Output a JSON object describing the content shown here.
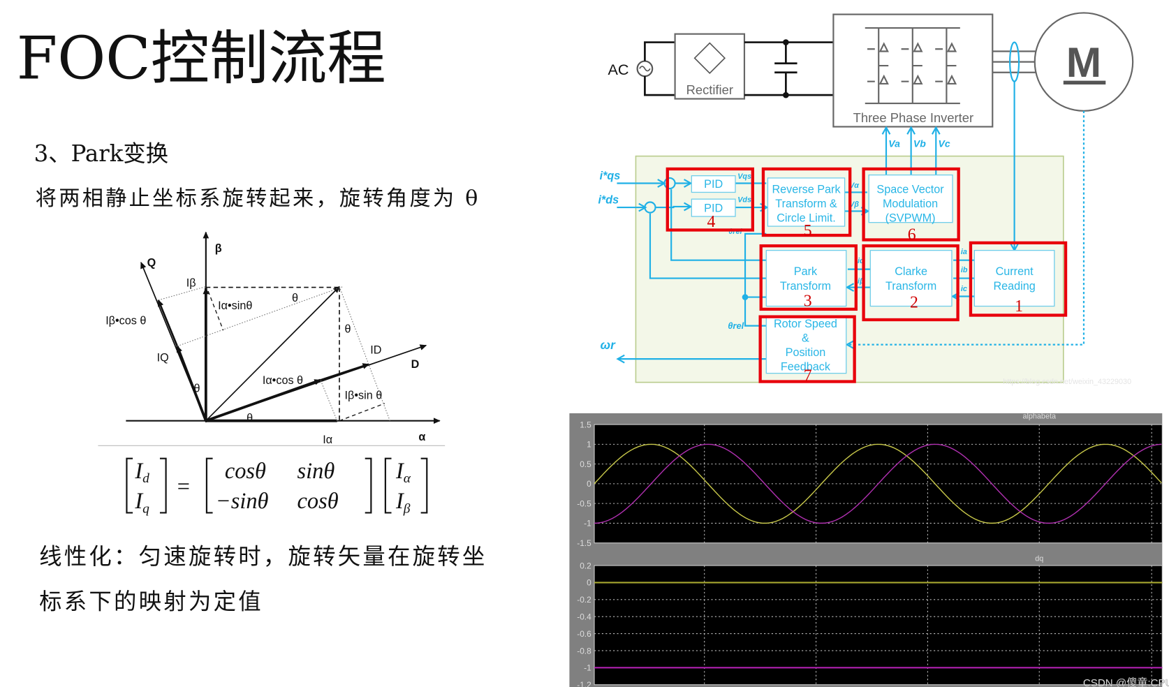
{
  "slide": {
    "title": "FOC控制流程",
    "subtitle": "3、Park变换",
    "description": "将两相静止坐标系旋转起来，旋转角度为 θ",
    "conclusion_line1": "线性化：匀速旋转时，旋转矢量在旋转坐",
    "conclusion_line2": "标系下的映射为定值",
    "watermark": "CSDN @傻童:CPU",
    "faint_url": "https://blog.csdn.net/weixin_43229030"
  },
  "phasor": {
    "alpha_axis": "α",
    "beta_axis": "β",
    "q_axis": "Q",
    "d_axis": "D",
    "i_beta": "Iβ",
    "i_alpha": "Iα",
    "i_alpha_sin": "Iα•sinθ",
    "i_beta_cos": "Iβ•cos θ",
    "iq": "IQ",
    "id": "ID",
    "i_alpha_cos": "Iα•cos θ",
    "i_beta_sin": "Iβ•sin θ",
    "theta": "θ"
  },
  "equation": {
    "lhs": [
      "I_d",
      "I_q"
    ],
    "matrix": [
      [
        "cosθ",
        "sinθ"
      ],
      [
        "−sinθ",
        "cosθ"
      ]
    ],
    "rhs": [
      "I_α",
      "I_β"
    ],
    "equals": "="
  },
  "power_stage": {
    "ac": "AC",
    "rectifier": "Rectifier",
    "inverter": "Three Phase Inverter",
    "motor": "M"
  },
  "control": {
    "inputs": [
      "i*qs",
      "i*ds"
    ],
    "output": "ωr",
    "voltages": [
      "Va",
      "Vb",
      "Vc"
    ],
    "signals": {
      "vqs": "Vqs",
      "vds": "Vds",
      "valpha": "Vα",
      "vbeta": "Vβ",
      "theta_rel": "θrel",
      "ia": "ia",
      "ib": "ib",
      "ic": "ic",
      "ialpha": "iα",
      "ibeta": "iβ"
    },
    "blocks": [
      {
        "id": "current_reading",
        "lines": [
          "Current",
          "Reading"
        ],
        "number": "1"
      },
      {
        "id": "clarke",
        "lines": [
          "Clarke",
          "Transform"
        ],
        "number": "2"
      },
      {
        "id": "park",
        "lines": [
          "Park",
          "Transform"
        ],
        "number": "3"
      },
      {
        "id": "pid",
        "lines": [
          "PID",
          "PID"
        ],
        "number": "4"
      },
      {
        "id": "reverse_park",
        "lines": [
          "Reverse Park",
          "Transform &",
          "Circle Limit."
        ],
        "number": "5"
      },
      {
        "id": "svpwm",
        "lines": [
          "Space Vector",
          "Modulation",
          "(SVPWM)"
        ],
        "number": "6"
      },
      {
        "id": "rotor",
        "lines": [
          "Rotor Speed",
          "&",
          "Position",
          "Feedback"
        ],
        "number": "7"
      }
    ],
    "colors": {
      "signal": "#1fb0e6",
      "highlight": "#e8000b",
      "background": "#f3f7e8"
    }
  },
  "chart_data": [
    {
      "type": "line",
      "title": "alphabeta",
      "ylim": [
        -1.5,
        1.5
      ],
      "yticks": [
        "1.5",
        "1",
        "0.5",
        "0",
        "-0.5",
        "-1",
        "-1.5"
      ],
      "grid": true,
      "cycles_shown": 2.5,
      "series": [
        {
          "color": "#c8c84a",
          "waveform": "sin",
          "amplitude": 1,
          "start_value": 0
        },
        {
          "color": "#b030b0",
          "waveform": "-cos",
          "amplitude": 1,
          "start_value": -1
        }
      ]
    },
    {
      "type": "line",
      "title": "dq",
      "ylim": [
        -1.2,
        0.2
      ],
      "yticks": [
        "0.2",
        "0",
        "-0.2",
        "-0.4",
        "-0.6",
        "-0.8",
        "-1",
        "-1.2"
      ],
      "grid": true,
      "series": [
        {
          "color": "#a8a830",
          "constant": 0
        },
        {
          "color": "#b020b0",
          "constant": -1
        }
      ]
    }
  ]
}
